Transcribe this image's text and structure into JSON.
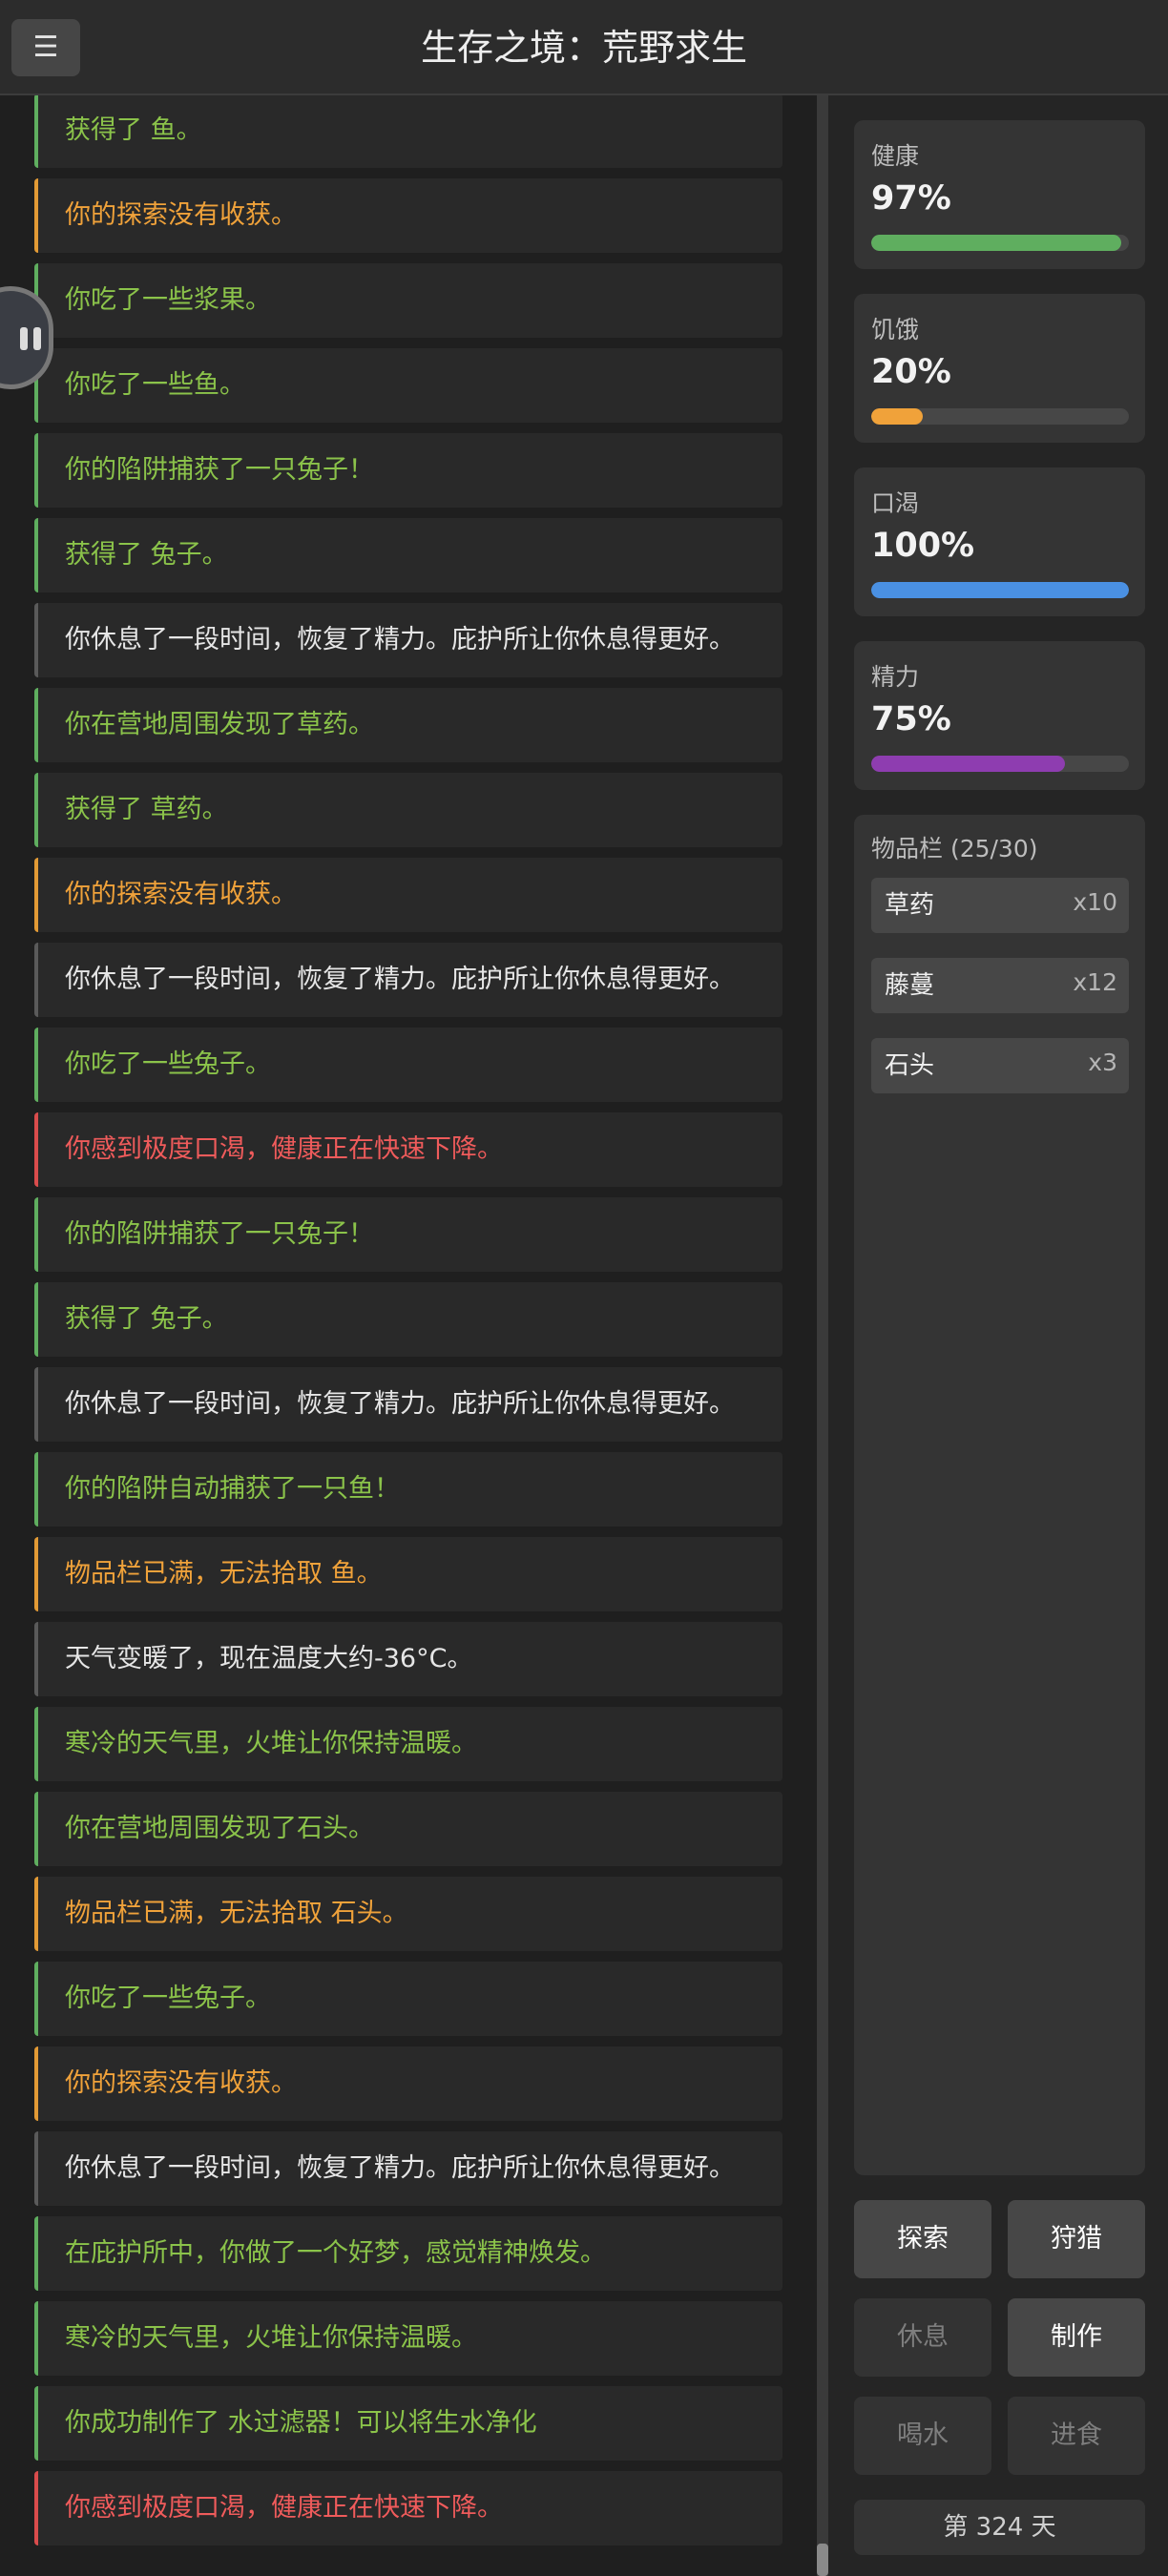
{
  "header": {
    "menu_icon": "☰",
    "title": "生存之境：荒野求生"
  },
  "log": [
    {
      "text": "获得了 鱼。",
      "type": "good"
    },
    {
      "text": "你的探索没有收获。",
      "type": "warn"
    },
    {
      "text": "你吃了一些浆果。",
      "type": "good"
    },
    {
      "text": "你吃了一些鱼。",
      "type": "good"
    },
    {
      "text": "你的陷阱捕获了一只兔子！",
      "type": "good"
    },
    {
      "text": "获得了 兔子。",
      "type": "good"
    },
    {
      "text": "你休息了一段时间，恢复了精力。庇护所让你休息得更好。",
      "type": "info"
    },
    {
      "text": "你在营地周围发现了草药。",
      "type": "good"
    },
    {
      "text": "获得了 草药。",
      "type": "good"
    },
    {
      "text": "你的探索没有收获。",
      "type": "warn"
    },
    {
      "text": "你休息了一段时间，恢复了精力。庇护所让你休息得更好。",
      "type": "info"
    },
    {
      "text": "你吃了一些兔子。",
      "type": "good"
    },
    {
      "text": "你感到极度口渴，健康正在快速下降。",
      "type": "bad"
    },
    {
      "text": "你的陷阱捕获了一只兔子！",
      "type": "good"
    },
    {
      "text": "获得了 兔子。",
      "type": "good"
    },
    {
      "text": "你休息了一段时间，恢复了精力。庇护所让你休息得更好。",
      "type": "info"
    },
    {
      "text": "你的陷阱自动捕获了一只鱼！",
      "type": "good"
    },
    {
      "text": "物品栏已满，无法拾取 鱼。",
      "type": "warn"
    },
    {
      "text": "天气变暖了，现在温度大约-36°C。",
      "type": "info"
    },
    {
      "text": "寒冷的天气里，火堆让你保持温暖。",
      "type": "good"
    },
    {
      "text": "你在营地周围发现了石头。",
      "type": "good"
    },
    {
      "text": "物品栏已满，无法拾取 石头。",
      "type": "warn"
    },
    {
      "text": "你吃了一些兔子。",
      "type": "good"
    },
    {
      "text": "你的探索没有收获。",
      "type": "warn"
    },
    {
      "text": "你休息了一段时间，恢复了精力。庇护所让你休息得更好。",
      "type": "info"
    },
    {
      "text": "在庇护所中，你做了一个好梦，感觉精神焕发。",
      "type": "good"
    },
    {
      "text": "寒冷的天气里，火堆让你保持温暖。",
      "type": "good"
    },
    {
      "text": "你成功制作了 水过滤器！可以将生水净化",
      "type": "good"
    },
    {
      "text": "你感到极度口渴，健康正在快速下降。",
      "type": "bad"
    }
  ],
  "stats": [
    {
      "key": "health",
      "label": "健康",
      "value": "97%",
      "percent": 97,
      "color": "#5fae5f"
    },
    {
      "key": "hunger",
      "label": "饥饿",
      "value": "20%",
      "percent": 20,
      "color": "#f0a23a"
    },
    {
      "key": "thirst",
      "label": "口渴",
      "value": "100%",
      "percent": 100,
      "color": "#4a90e2"
    },
    {
      "key": "energy",
      "label": "精力",
      "value": "75%",
      "percent": 75,
      "color": "#8e3db0"
    }
  ],
  "inventory": {
    "title": "物品栏 (25/30)",
    "items": [
      {
        "name": "草药",
        "count": "x10"
      },
      {
        "name": "藤蔓",
        "count": "x12"
      },
      {
        "name": "石头",
        "count": "x3"
      }
    ]
  },
  "actions": [
    {
      "key": "explore",
      "label": "探索",
      "enabled": true
    },
    {
      "key": "hunt",
      "label": "狩猎",
      "enabled": true
    },
    {
      "key": "rest",
      "label": "休息",
      "enabled": false
    },
    {
      "key": "craft",
      "label": "制作",
      "enabled": true
    },
    {
      "key": "drink",
      "label": "喝水",
      "enabled": false
    },
    {
      "key": "eat",
      "label": "进食",
      "enabled": false
    }
  ],
  "day": "第 324 天"
}
